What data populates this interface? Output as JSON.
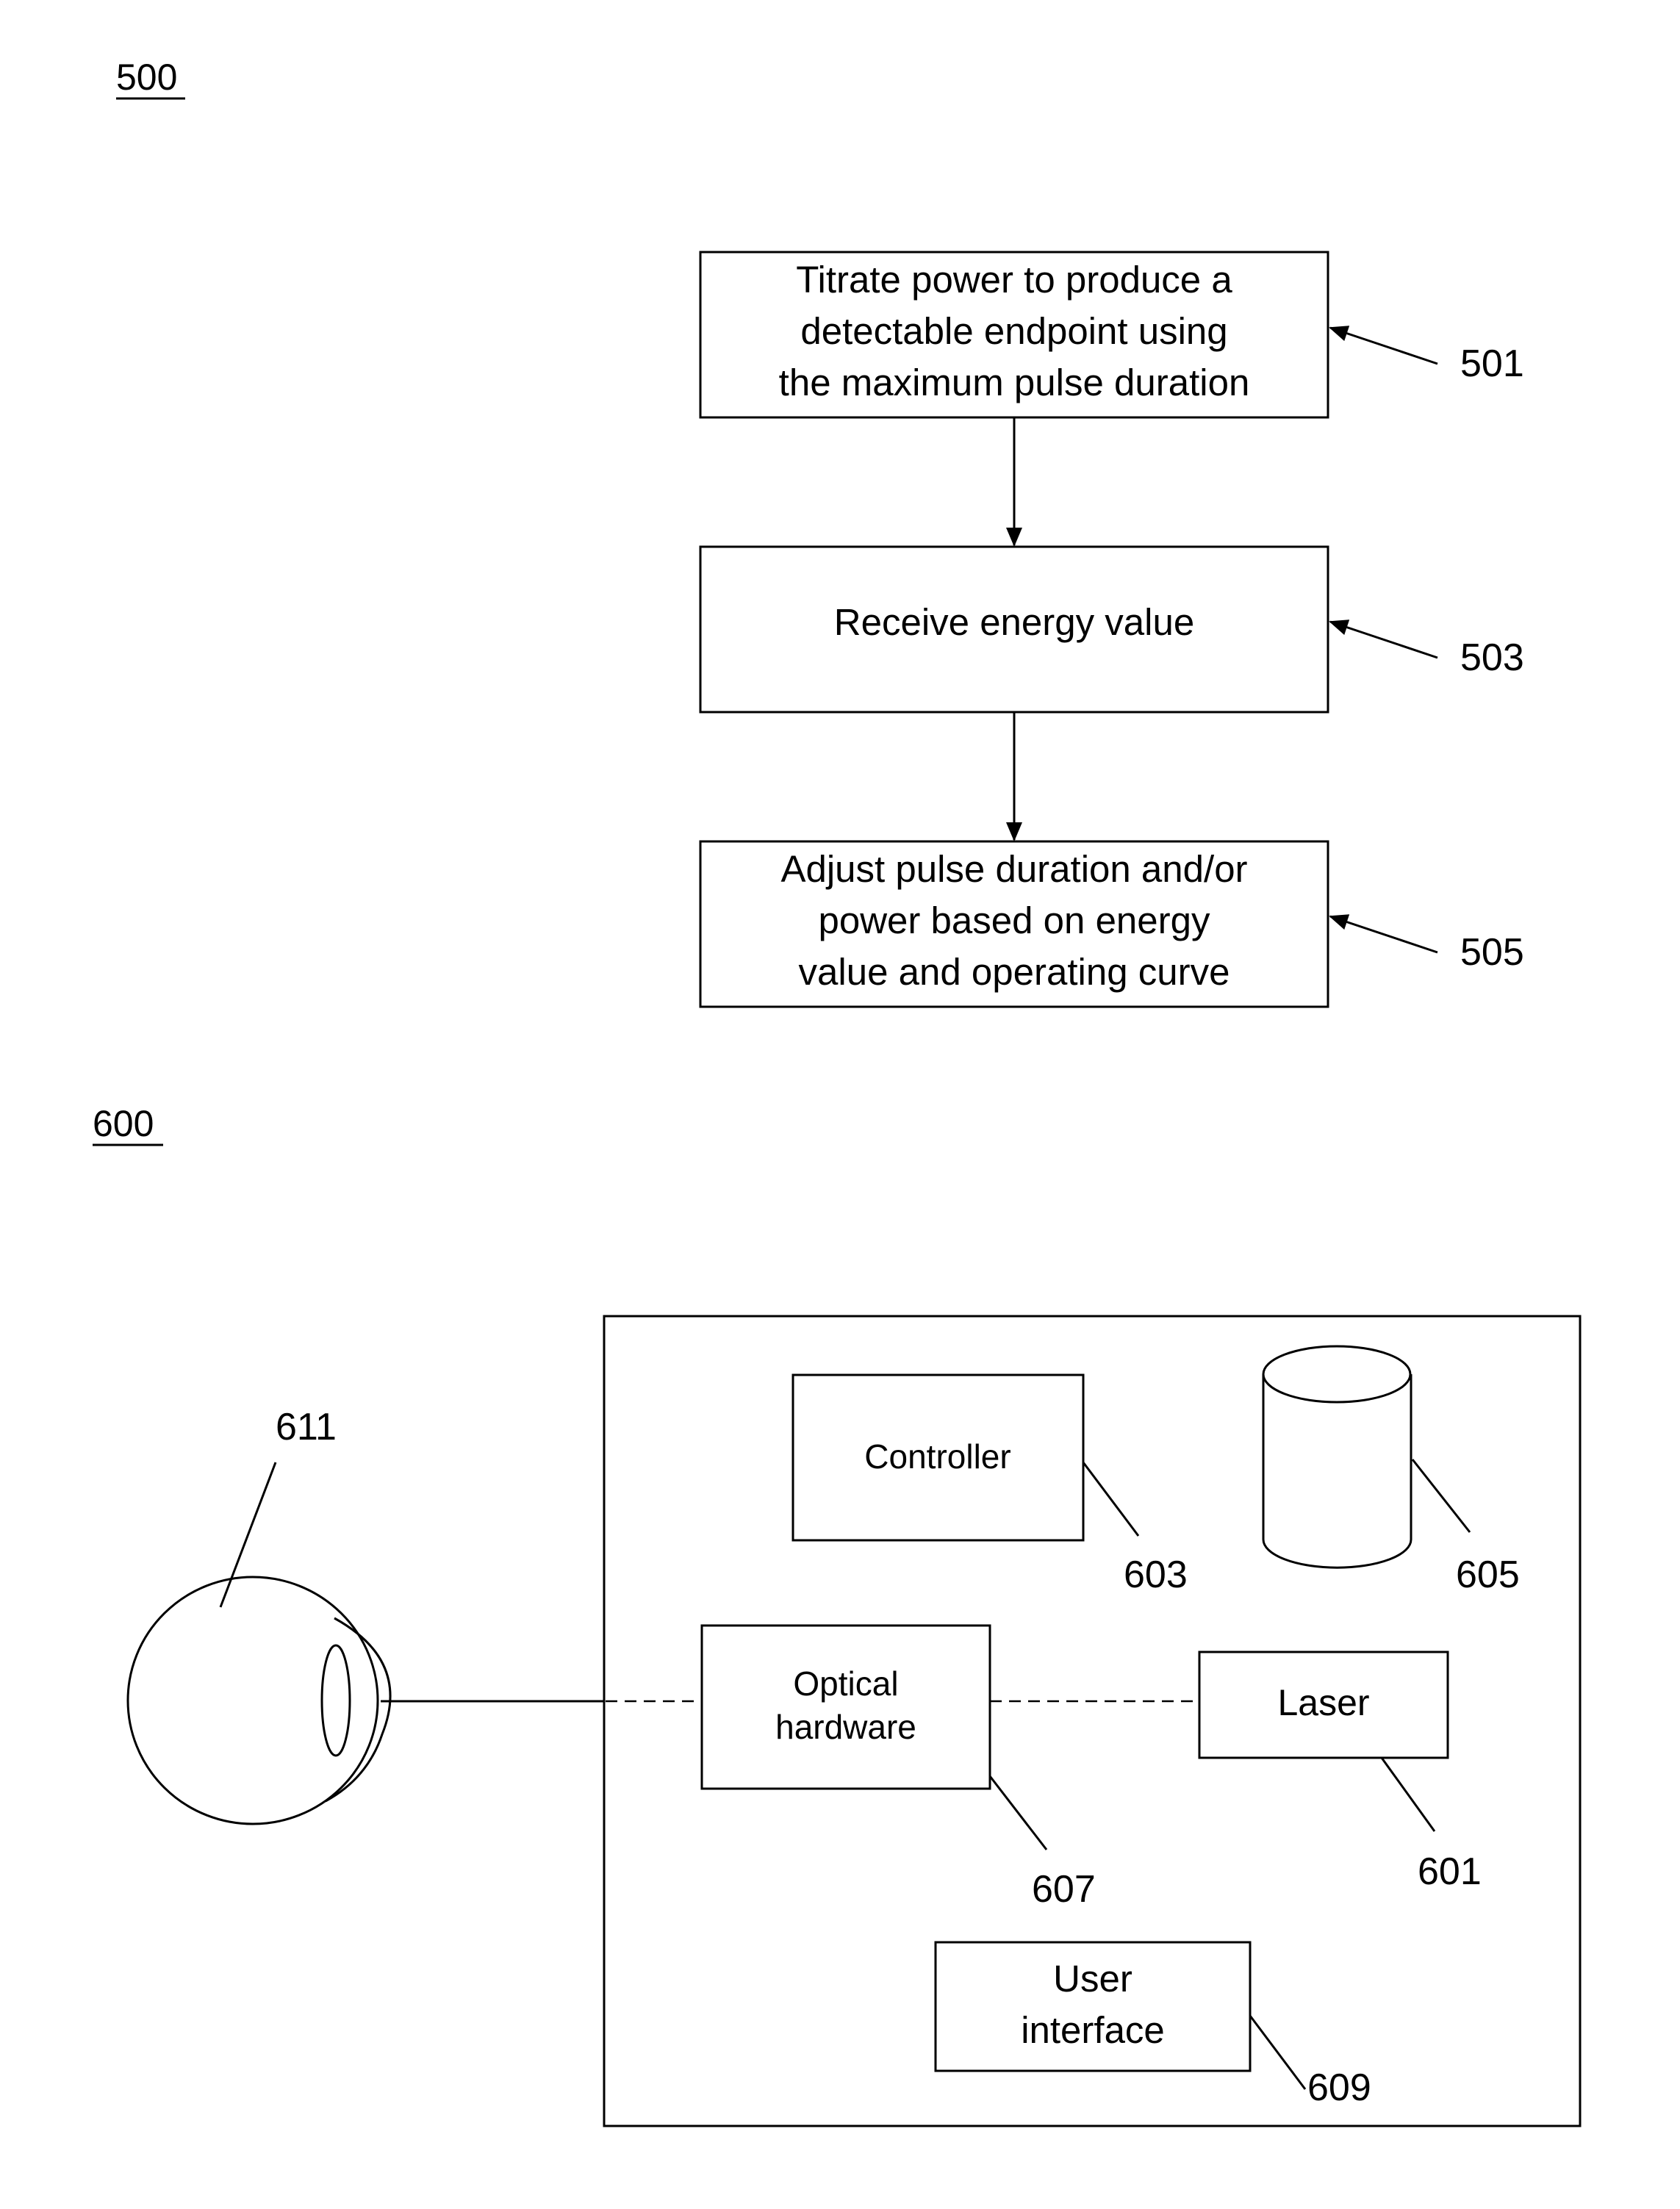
{
  "figure500": {
    "label": "500",
    "steps": [
      {
        "ref": "501",
        "lines": [
          "Titrate power to produce a",
          "detectable endpoint using",
          "the maximum pulse duration"
        ]
      },
      {
        "ref": "503",
        "lines": [
          "Receive energy value"
        ]
      },
      {
        "ref": "505",
        "lines": [
          "Adjust pulse duration and/or",
          "power based on energy",
          "value and operating curve"
        ]
      }
    ]
  },
  "figure600": {
    "label": "600",
    "eye_ref": "611",
    "controller": {
      "label": "Controller",
      "ref": "603"
    },
    "storage": {
      "ref": "605"
    },
    "optical": {
      "lines": [
        "Optical",
        "hardware"
      ],
      "ref": "607"
    },
    "laser": {
      "label": "Laser",
      "ref": "601"
    },
    "ui": {
      "lines": [
        "User",
        "interface"
      ],
      "ref": "609"
    }
  }
}
